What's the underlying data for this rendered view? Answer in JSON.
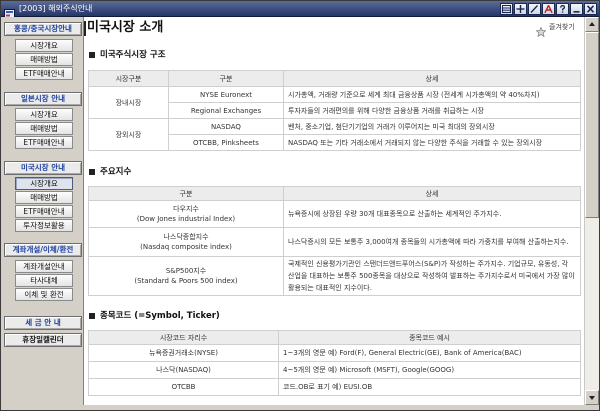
{
  "window": {
    "title": "[2003] 해외주식안내",
    "titlebar_icons": [
      "app-icon",
      "window-list-icon",
      "move-icon",
      "pencil-icon",
      "font-a-icon",
      "help-icon",
      "minimize-icon",
      "close-icon"
    ]
  },
  "sidebar": {
    "groups": [
      {
        "header": "홍콩/중국시장안내",
        "items": [
          {
            "label": "시장개요"
          },
          {
            "label": "매매방법"
          },
          {
            "label": "ETF매매안내"
          }
        ]
      },
      {
        "header": "일본시장 안내",
        "items": [
          {
            "label": "시장개요"
          },
          {
            "label": "매매방법"
          },
          {
            "label": "ETF매매안내"
          }
        ]
      },
      {
        "header": "미국시장 안내",
        "items": [
          {
            "label": "시장개요",
            "active": true
          },
          {
            "label": "매매방법"
          },
          {
            "label": "ETF매매안내"
          },
          {
            "label": "투자정보활용"
          }
        ]
      },
      {
        "header": "계좌개설/이체/환전",
        "items": [
          {
            "label": "계좌개설안내"
          },
          {
            "label": "타사대체"
          },
          {
            "label": "이체 및 환전"
          }
        ]
      }
    ],
    "tax_guide_label": "세 금 안 내",
    "holiday_calendar_label": "휴장일캘린더"
  },
  "main": {
    "page_title": "미국시장 소개",
    "favorite": {
      "label": "즐겨찾기",
      "icon": "star-icon"
    },
    "market_structure": {
      "heading": "미국주식시장 구조",
      "headers": [
        "시장구분",
        "구분",
        "상세"
      ],
      "groups": [
        {
          "market": "장내시장",
          "rows": [
            {
              "name": "NYSE Euronext",
              "detail": "시가총액, 거래량 기준으로 세계 최대 금융상품 시장 (전세계 시가총액의 약 40%차지)"
            },
            {
              "name": "Regional Exchanges",
              "detail": "투자자들의 거래편의를 위해 다양한 금융상품 거래를 취급하는 시장"
            }
          ]
        },
        {
          "market": "장외시장",
          "rows": [
            {
              "name": "NASDAQ",
              "detail": "벤처, 중소기업, 첨단기기업의 거래가 이루어지는 미국 최대의 장외시장"
            },
            {
              "name": "OTCBB, Pinksheets",
              "detail": "NASDAQ 또는 기타 거래소에서 거래되지 않는 다양한 주식을 거래할 수 있는 장외시장"
            }
          ]
        }
      ]
    },
    "major_indices": {
      "heading": "주요지수",
      "headers": [
        "구분",
        "상세"
      ],
      "rows": [
        {
          "name": "다우지수",
          "name_en": "(Dow Jones industrial Index)",
          "detail": "뉴욕증시에 상장된 우량 30개 대표종목으로 산출하는 세계적인 주가지수."
        },
        {
          "name": "나스닥종합지수",
          "name_en": "(Nasdaq composite index)",
          "detail": "나스닥증시의 모든 보통주 3,000여개 종목들의 시가총액에 따라 가중치를 부여해 산출하는지수."
        },
        {
          "name": "S&P500지수",
          "name_en": "(Standard & Poors 500 index)",
          "detail": "국제적인 신용평가기관인 스탠더드앤드푸어스(S&P)가 작성하는 주가지수. 기업규모, 유동성, 각 산업을 대표하는 보통주 500종목을 대상으로 작성하여 발표하는 주가지수로서 미국에서 가장 많이 활용되는 대표적인 지수이다."
        }
      ]
    },
    "ticker_codes": {
      "heading": "종목코드 (=Symbol, Ticker)",
      "headers": [
        "시장코드 자리수",
        "종목코드 예시"
      ],
      "rows": [
        {
          "market": "뉴욕증권거래소(NYSE)",
          "example": "1~3개의 영문 예) Ford(F), General Electric(GE), Bank of America(BAC)"
        },
        {
          "market": "나스닥(NASDAQ)",
          "example": "4~5개의 영문 예) Microsoft (MSFT), Google(GOOG)"
        },
        {
          "market": "OTCBB",
          "example": "코드.OB로 표기 예) EUSI.OB"
        }
      ]
    }
  },
  "colors": {
    "titlebar": "#24356a",
    "sidebar_background": "#d4d0c8",
    "sidebar_header_text": "#1c3e9e",
    "table_header_background": "#ececec",
    "table_border": "#cfcfcf"
  }
}
